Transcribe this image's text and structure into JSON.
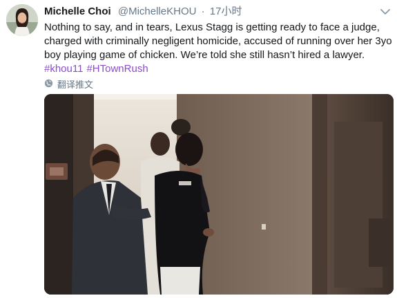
{
  "tweet": {
    "author_name": "Michelle Choi",
    "author_handle": "@MichelleKHOU",
    "separator": "·",
    "time": "17小时",
    "text": "Nothing to say, and in tears, Lexus Stagg is getting ready to face a judge, charged with criminally negligent homicide, accused of running over her 3yo boy playing game of chicken. We’re told she still hasn’t hired a lawyer.",
    "hashtags": [
      "#khou11",
      "#HTownRush"
    ],
    "translate_label": "翻译推文"
  },
  "icons": {
    "avatar": "avatar",
    "menu": "chevron-down-icon",
    "translate": "globe-icon",
    "media": "video-frame"
  },
  "colors": {
    "name": "#14171a",
    "muted": "#657786",
    "hashtag": "#8b4cc9"
  }
}
